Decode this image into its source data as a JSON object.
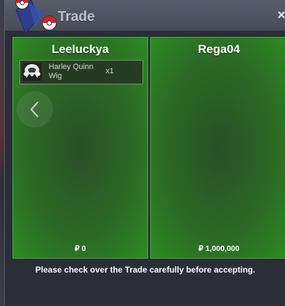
{
  "window": {
    "title": "Trade",
    "close_glyph": "×",
    "logo_icon": "pokeball-emblem-icon"
  },
  "left_panel": {
    "player_name": "Leeluckya",
    "items": [
      {
        "icon": "wig-icon",
        "name": "Harley Quinn Wig",
        "quantity": "x1"
      }
    ],
    "money": "₽ 0"
  },
  "right_panel": {
    "player_name": "Rega04",
    "items": [],
    "money": "₽ 1,000,000"
  },
  "navigation": {
    "prev_icon": "chevron-left-icon"
  },
  "footer": {
    "notice": "Please check over the Trade carefully before accepting."
  },
  "colors": {
    "panel_border": "#46b43a",
    "panel_fill": "#2b6b24",
    "window_bg": "#2b2d39",
    "titlebar": "#4e515e"
  }
}
